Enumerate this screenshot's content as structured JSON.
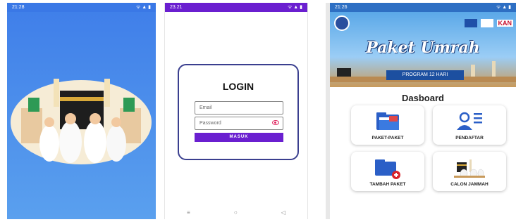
{
  "splash": {
    "status_time": "21:28",
    "status_right": "ᯤ ▲ ▮"
  },
  "login": {
    "status_time": "23.21",
    "status_right": "ᯤ ▲ ▮",
    "title": "LOGIN",
    "email_placeholder": "Email",
    "password_placeholder": "Password",
    "submit_label": "MASUK",
    "nav": [
      "≡",
      "○",
      "◁"
    ]
  },
  "dashboard": {
    "status_time": "21:26",
    "status_right": "ᯤ ▲ ▮",
    "banner_title": "Paket Umrah",
    "banner_subtitle": "PROGRAM 12 HARI",
    "logo_text": "KAN",
    "title": "Dasboard",
    "menu": [
      {
        "label": "PAKET-PAKET",
        "icon": "folder-icon"
      },
      {
        "label": "PENDAFTAR",
        "icon": "user-list-icon"
      },
      {
        "label": "TAMBAH PAKET",
        "icon": "add-folder-icon"
      },
      {
        "label": "CALON JAMMAH",
        "icon": "pilgrims-icon"
      }
    ]
  },
  "colors": {
    "splash_bg": "#3f7ee9",
    "primary_purple": "#6a1fd0",
    "card_border": "#3a3f8f",
    "banner_blue": "#1c4fa0"
  }
}
